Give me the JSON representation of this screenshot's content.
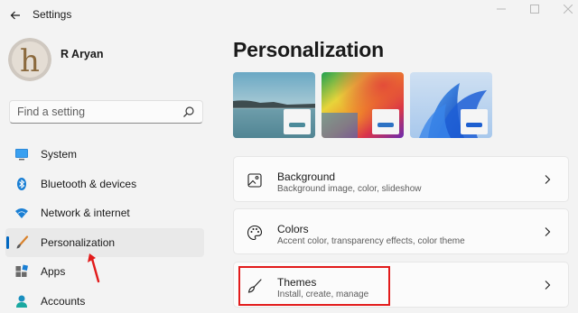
{
  "window": {
    "title": "Settings"
  },
  "user": {
    "name": "R Aryan"
  },
  "search": {
    "placeholder": "Find a setting"
  },
  "sidebar": {
    "items": [
      {
        "label": "System",
        "icon": "system-icon"
      },
      {
        "label": "Bluetooth & devices",
        "icon": "bluetooth-icon"
      },
      {
        "label": "Network & internet",
        "icon": "wifi-icon"
      },
      {
        "label": "Personalization",
        "icon": "brush-icon",
        "selected": true
      },
      {
        "label": "Apps",
        "icon": "apps-icon"
      },
      {
        "label": "Accounts",
        "icon": "accounts-icon"
      }
    ]
  },
  "main": {
    "title": "Personalization",
    "themes_preview": [
      "lake-theme",
      "rainbow-theme",
      "bloom-theme"
    ],
    "cards": [
      {
        "title": "Background",
        "description": "Background image, color, slideshow",
        "icon": "image-icon"
      },
      {
        "title": "Colors",
        "description": "Accent color, transparency effects, color theme",
        "icon": "palette-icon"
      },
      {
        "title": "Themes",
        "description": "Install, create, manage",
        "icon": "brush-icon"
      }
    ]
  },
  "colors": {
    "accent": "#0067c0",
    "annotation": "#e21b1b"
  }
}
